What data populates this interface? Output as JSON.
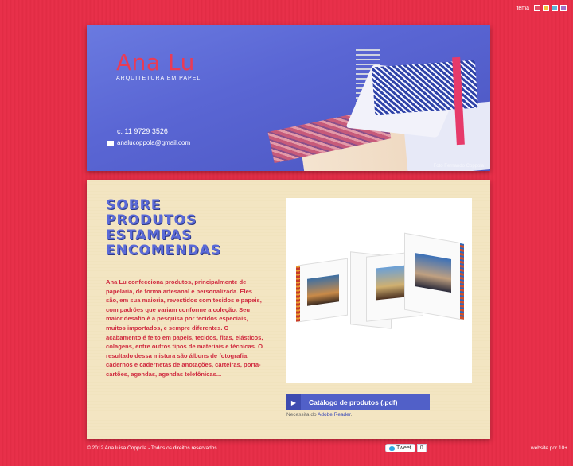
{
  "theme": {
    "label": "tema",
    "swatches": [
      "#e14b63",
      "#f0c23a",
      "#5bb3d8",
      "#a070c8"
    ]
  },
  "header": {
    "brand_name": "Ana Lu",
    "brand_tagline": "ARQUITETURA EM PAPEL",
    "phone": "c. 11 9729 3526",
    "email": "analucoppola@gmail.com",
    "photo_credit": "Foto Fernando Coppola"
  },
  "nav": {
    "items": [
      {
        "label": "Sobre"
      },
      {
        "label": "Produtos"
      },
      {
        "label": "Estampas"
      },
      {
        "label": "Encomendas"
      }
    ]
  },
  "about": {
    "text": "Ana Lu confecciona produtos, principalmente de papelaria, de forma artesanal e personalizada. Eles são, em sua maioria, revestidos com tecidos e papeis, com padrões que variam conforme a coleção. Seu maior desafio é a pesquisa por tecidos especiais, muitos importados, e sempre diferentes. O acabamento é feito em papeis, tecidos, fitas, elásticos, colagens, entre outros tipos de materiais e técnicas. O resultado dessa mistura são álbuns de fotografia, cadernos e cadernetas de anotações, carteiras, porta-cartões, agendas, agendas telefônicas..."
  },
  "catalog": {
    "button_label": "Catálogo de produtos (.pdf)",
    "note_prefix": "Necessita do",
    "note_link": "Adobe Reader",
    "note_suffix": "."
  },
  "footer": {
    "copyright": "© 2012 Ana luisa Coppola - Todos os direitos reservados",
    "tweet_label": "Tweet",
    "tweet_count": "0",
    "credit": "website por 10+"
  }
}
